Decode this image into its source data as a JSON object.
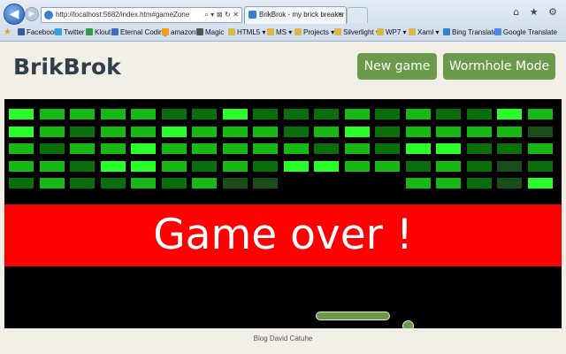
{
  "browser": {
    "url": "http://localhost:5682/index.htm#gameZone",
    "address_tools": "⌕ ▾ ⊠ ↻ ✕",
    "tab_title": "BrikBrok - my brick breaker ...",
    "tab_close": "✕",
    "right_icons": "⌂ ★ ⚙",
    "favorites": [
      {
        "label": "Facebook",
        "color": "#3b5998"
      },
      {
        "label": "Twitter",
        "color": "#33a6d8"
      },
      {
        "label": "Klout",
        "color": "#2f9c4a"
      },
      {
        "label": "Eternal Coding",
        "color": "#3a6fb8"
      },
      {
        "label": "amazon.fr",
        "color": "#f39c12"
      },
      {
        "label": "Magic",
        "color": "#555555"
      },
      {
        "label": "HTML5 ▾",
        "color": "#d8b84a"
      },
      {
        "label": "MS ▾",
        "color": "#d8b84a"
      },
      {
        "label": "Projects ▾",
        "color": "#d8b84a"
      },
      {
        "label": "Silverlight ▾",
        "color": "#d8b84a"
      },
      {
        "label": "WP7 ▾",
        "color": "#d8b84a"
      },
      {
        "label": "Xaml ▾",
        "color": "#d8b84a"
      },
      {
        "label": "Bing Translator",
        "color": "#3a7fd0"
      },
      {
        "label": "Google Translate",
        "color": "#4a8af0"
      }
    ]
  },
  "app": {
    "title": "BrikBrok",
    "new_game": "New game",
    "wormhole_mode": "Wormhole Mode"
  },
  "game": {
    "status": "Game over !",
    "brick_colors": [
      "#1a4d1a",
      "#0a6f0a",
      "#17b917",
      "#29ff29"
    ],
    "bricks": [
      [
        3,
        2,
        2,
        2,
        2,
        1,
        1,
        3,
        1,
        1,
        1,
        2,
        1,
        2,
        1,
        1,
        3,
        2
      ],
      [
        3,
        2,
        1,
        2,
        2,
        3,
        2,
        2,
        2,
        1,
        2,
        3,
        1,
        2,
        2,
        2,
        2,
        0
      ],
      [
        2,
        1,
        2,
        2,
        3,
        2,
        2,
        2,
        2,
        2,
        1,
        2,
        1,
        3,
        3,
        1,
        1,
        2
      ],
      [
        2,
        2,
        1,
        3,
        3,
        2,
        1,
        2,
        1,
        3,
        3,
        2,
        2,
        1,
        2,
        1,
        0,
        1
      ],
      [
        1,
        2,
        1,
        1,
        2,
        1,
        2,
        0,
        0,
        -1,
        -1,
        -1,
        -1,
        2,
        2,
        1,
        0,
        3
      ]
    ]
  },
  "footer": {
    "text": "Blog David Catuhe"
  }
}
